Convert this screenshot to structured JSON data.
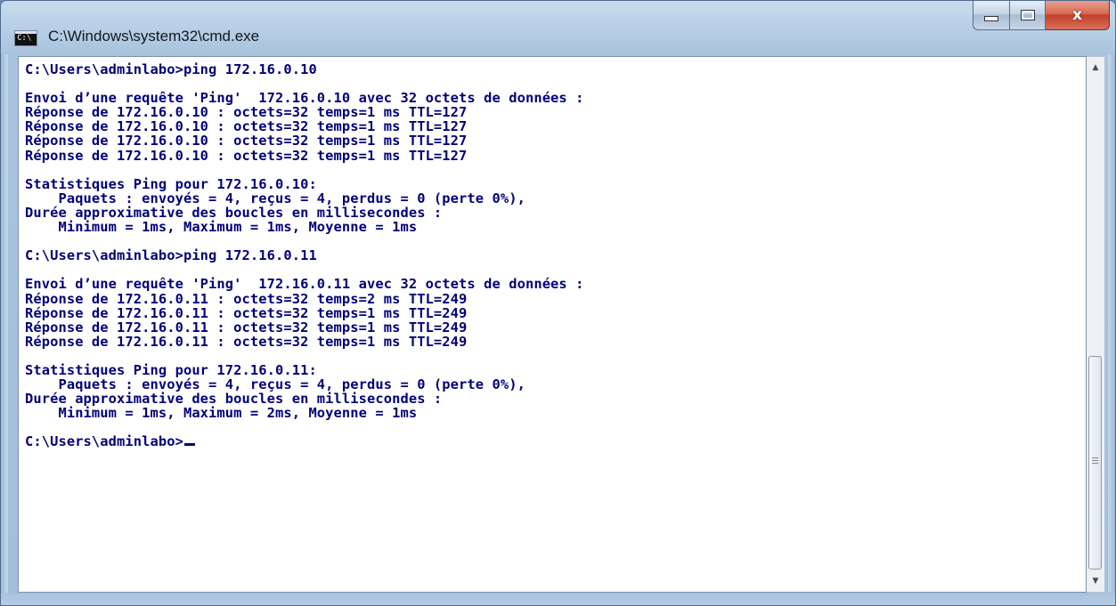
{
  "window": {
    "title": "C:\\Windows\\system32\\cmd.exe",
    "icon_text": "C:\\",
    "icon": "console-app-icon",
    "controls": {
      "minimize_icon": "minimize-icon",
      "maximize_icon": "maximize-icon",
      "close_icon": "close-icon",
      "close_glyph": "x"
    }
  },
  "console": {
    "text_color": "#00007a",
    "background": "#ffffff",
    "lines": [
      "C:\\Users\\adminlabo>ping 172.16.0.10",
      "",
      "Envoi d’une requête 'Ping'  172.16.0.10 avec 32 octets de données :",
      "Réponse de 172.16.0.10 : octets=32 temps=1 ms TTL=127",
      "Réponse de 172.16.0.10 : octets=32 temps=1 ms TTL=127",
      "Réponse de 172.16.0.10 : octets=32 temps=1 ms TTL=127",
      "Réponse de 172.16.0.10 : octets=32 temps=1 ms TTL=127",
      "",
      "Statistiques Ping pour 172.16.0.10:",
      "    Paquets : envoyés = 4, reçus = 4, perdus = 0 (perte 0%),",
      "Durée approximative des boucles en millisecondes :",
      "    Minimum = 1ms, Maximum = 1ms, Moyenne = 1ms",
      "",
      "C:\\Users\\adminlabo>ping 172.16.0.11",
      "",
      "Envoi d’une requête 'Ping'  172.16.0.11 avec 32 octets de données :",
      "Réponse de 172.16.0.11 : octets=32 temps=2 ms TTL=249",
      "Réponse de 172.16.0.11 : octets=32 temps=1 ms TTL=249",
      "Réponse de 172.16.0.11 : octets=32 temps=1 ms TTL=249",
      "Réponse de 172.16.0.11 : octets=32 temps=1 ms TTL=249",
      "",
      "Statistiques Ping pour 172.16.0.11:",
      "    Paquets : envoyés = 4, reçus = 4, perdus = 0 (perte 0%),",
      "Durée approximative des boucles en millisecondes :",
      "    Minimum = 1ms, Maximum = 2ms, Moyenne = 1ms",
      "",
      "C:\\Users\\adminlabo>"
    ]
  },
  "scrollbar": {
    "up_icon": "scroll-up-arrow-icon",
    "down_icon": "scroll-down-arrow-icon",
    "thumb_icon": "scroll-thumb-grip-icon",
    "up_glyph": "▲",
    "down_glyph": "▼"
  }
}
